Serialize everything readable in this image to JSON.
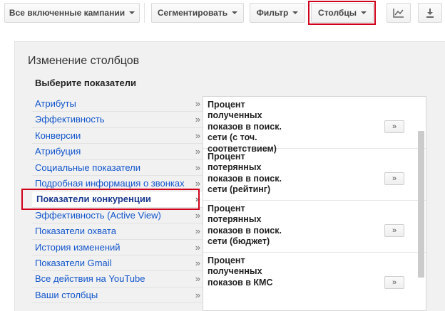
{
  "toolbar": {
    "campaigns_label": "Все включенные кампании",
    "segment_label": "Сегментировать",
    "filter_label": "Фильтр",
    "columns_label": "Столбцы"
  },
  "panel": {
    "title": "Изменение столбцов",
    "subtitle": "Выберите показатели"
  },
  "categories": [
    {
      "label": "Атрибуты",
      "arrow": "»"
    },
    {
      "label": "Эффективность",
      "arrow": "»"
    },
    {
      "label": "Конверсии",
      "arrow": "»"
    },
    {
      "label": "Атрибуция",
      "arrow": "»"
    },
    {
      "label": "Социальные показатели",
      "arrow": "»"
    },
    {
      "label": "Подробная информация о звонках",
      "arrow": "»"
    },
    {
      "label": "Показатели конкуренции",
      "arrow": "»"
    },
    {
      "label": "Эффективность (Active View)",
      "arrow": "»"
    },
    {
      "label": "Показатели охвата",
      "arrow": "»"
    },
    {
      "label": "История изменений",
      "arrow": "»"
    },
    {
      "label": "Показатели Gmail",
      "arrow": "»"
    },
    {
      "label": "Все действия на YouTube",
      "arrow": "»"
    },
    {
      "label": "Ваши столбцы",
      "arrow": "»"
    }
  ],
  "metrics": [
    {
      "label": "Процент полученных показов в поиск. сети (с точ. соответствием)",
      "add": "»"
    },
    {
      "label": "Процент потерянных показов в поиск. сети (рейтинг)",
      "add": "»"
    },
    {
      "label": "Процент потерянных показов в поиск. сети (бюджет)",
      "add": "»"
    },
    {
      "label": "Процент полученных показов в КМС",
      "add": "»"
    }
  ],
  "icons": {
    "chart": "line-chart-icon",
    "download": "download-icon"
  },
  "colors": {
    "highlight": "#d0021b",
    "link": "#1155cc"
  }
}
